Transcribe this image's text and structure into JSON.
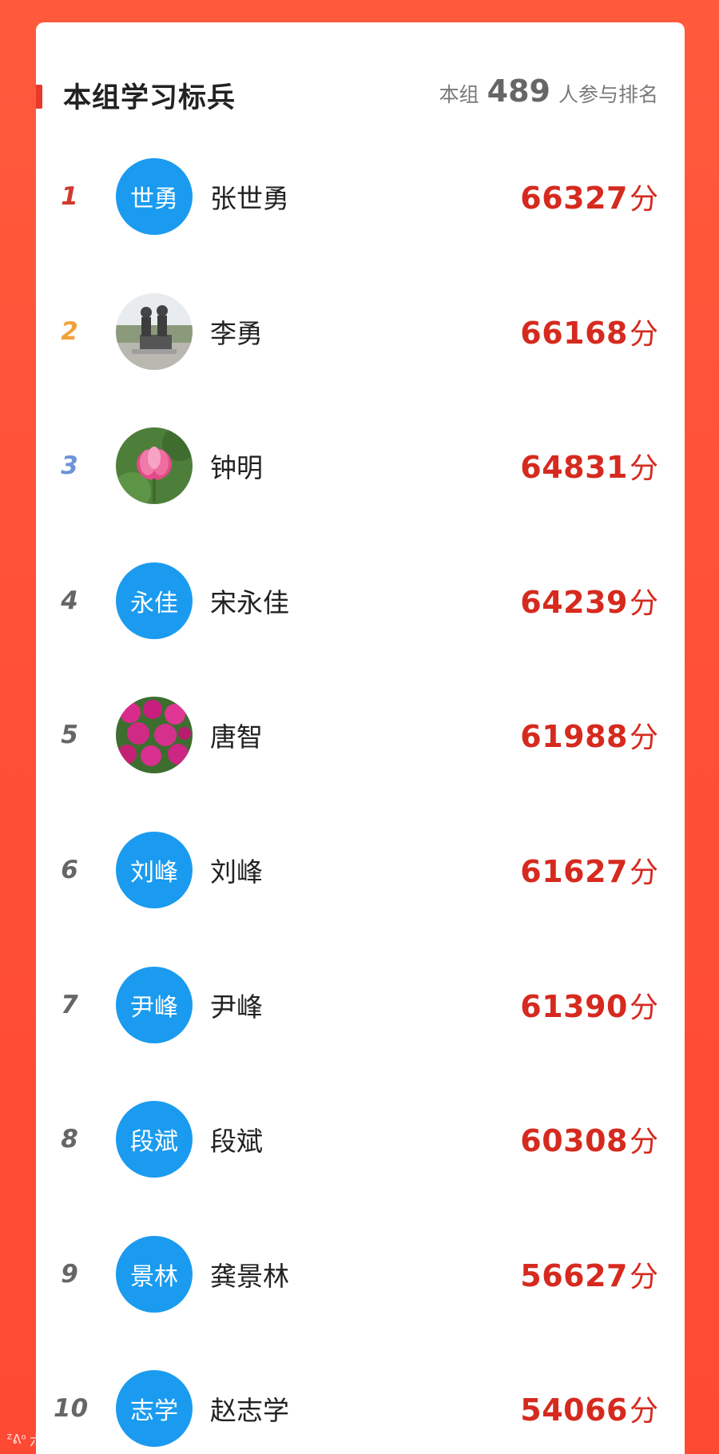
{
  "header": {
    "title": "本组学习标兵",
    "meta_prefix": "本组",
    "participant_count": "489",
    "meta_suffix": "人参与排名"
  },
  "score_unit": "分",
  "ranking": [
    {
      "rank": "1",
      "name": "张世勇",
      "avatar_text": "世勇",
      "avatar_type": "text",
      "score": "66327",
      "rank_color": "#d23a2c"
    },
    {
      "rank": "2",
      "name": "李勇",
      "avatar_text": "",
      "avatar_type": "photo-statue-icon",
      "score": "66168",
      "rank_color": "#f0a23a"
    },
    {
      "rank": "3",
      "name": "钟明",
      "avatar_text": "",
      "avatar_type": "photo-lotus-icon",
      "score": "64831",
      "rank_color": "#6f93d8"
    },
    {
      "rank": "4",
      "name": "宋永佳",
      "avatar_text": "永佳",
      "avatar_type": "text",
      "score": "64239",
      "rank_color": "#666666"
    },
    {
      "rank": "5",
      "name": "唐智",
      "avatar_text": "",
      "avatar_type": "photo-flowers-icon",
      "score": "61988",
      "rank_color": "#666666"
    },
    {
      "rank": "6",
      "name": "刘峰",
      "avatar_text": "刘峰",
      "avatar_type": "text",
      "score": "61627",
      "rank_color": "#666666"
    },
    {
      "rank": "7",
      "name": "尹峰",
      "avatar_text": "尹峰",
      "avatar_type": "text",
      "score": "61390",
      "rank_color": "#666666"
    },
    {
      "rank": "8",
      "name": "段斌",
      "avatar_text": "段斌",
      "avatar_type": "text",
      "score": "60308",
      "rank_color": "#666666"
    },
    {
      "rank": "9",
      "name": "龚景林",
      "avatar_text": "景林",
      "avatar_type": "text",
      "score": "56627",
      "rank_color": "#666666"
    },
    {
      "rank": "10",
      "name": "赵志学",
      "avatar_text": "志学",
      "avatar_type": "text",
      "score": "54066",
      "rank_color": "#666666"
    }
  ],
  "watermark": {
    "logo": "ᙆᕕᵒ",
    "text": "六般跨境"
  },
  "colors": {
    "background": "#ff4f37",
    "accent": "#e8392b",
    "score": "#d62a1f",
    "avatar_bg": "#1a9bf0"
  }
}
